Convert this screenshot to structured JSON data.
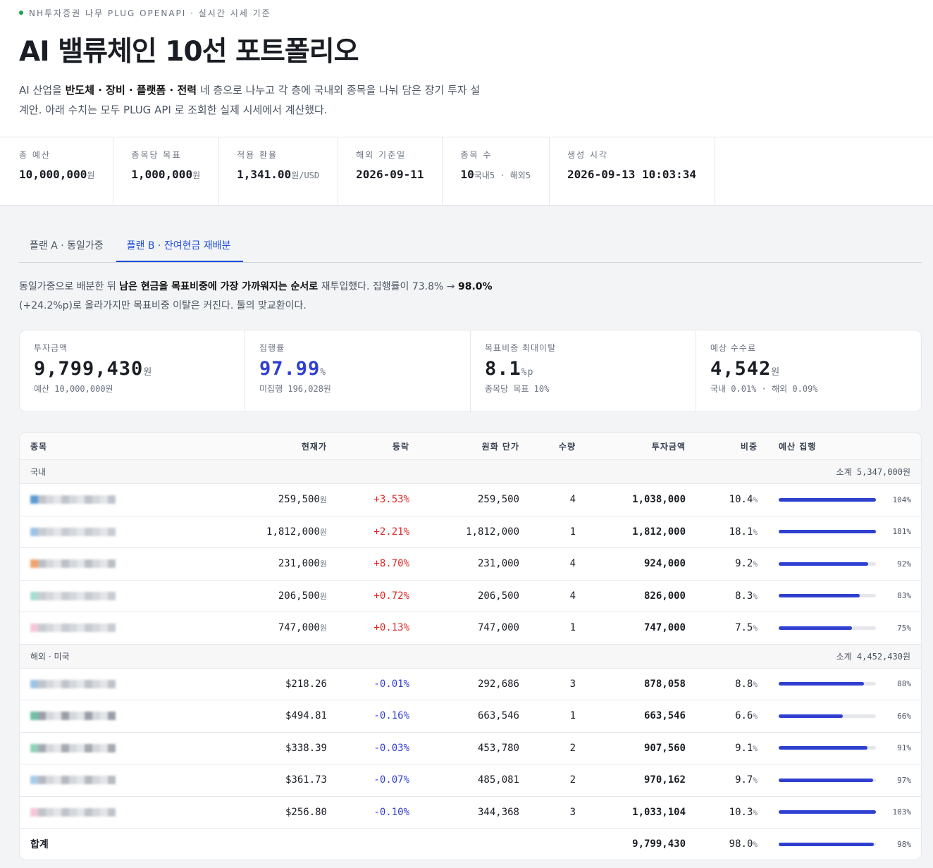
{
  "header": {
    "eyebrow": "NH투자증권 나무 PLUG OPENAPI · 실시간 시세 기준",
    "title": "AI 밸류체인 10선 포트폴리오",
    "desc_1": "AI 산업을 ",
    "desc_bold": "반도체 · 장비 · 플랫폼 · 전력",
    "desc_2": " 네 층으로 나누고 각 층에 국내외 종목을 나눠 담은 장기 투자 설계안. 아래 수치는 모두 PLUG API 로 조회한 실제 시세에서 계산했다."
  },
  "stats": [
    {
      "label": "총 예산",
      "value": "10,000,000",
      "unit": "원"
    },
    {
      "label": "종목당 목표",
      "value": "1,000,000",
      "unit": "원"
    },
    {
      "label": "적용 환율",
      "value": "1,341.00",
      "unit": "원/USD"
    },
    {
      "label": "해외 기준일",
      "value": "2026-09-11",
      "unit": ""
    },
    {
      "label": "종목 수",
      "value": "10",
      "unit": "국내5 · 해외5"
    },
    {
      "label": "생성 시각",
      "value": "2026-09-13 10:03:34",
      "unit": ""
    }
  ],
  "tabs": {
    "a": "플랜 A · 동일가중",
    "b": "플랜 B · 잔여현금 재배분"
  },
  "note": {
    "p1": "동일가중으로 배분한 뒤 ",
    "b1": "남은 현금을 목표비중에 가장 가까워지는 순서로",
    "p2": " 재투입했다. 집행률이 73.8% → ",
    "b2": "98.0%",
    "p3": " (+24.2%p)로 올라가지만 목표비중 이탈은 커진다. 둘의 맞교환이다."
  },
  "kpis": [
    {
      "label": "투자금액",
      "value": "9,799,430",
      "unit": "원",
      "sub": "예산 10,000,000원"
    },
    {
      "label": "집행률",
      "value": "97.99",
      "unit": "%",
      "sub": "미집행 196,028원"
    },
    {
      "label": "목표비중 최대이탈",
      "value": "8.1",
      "unit": "%p",
      "sub": "종목당 목표 10%"
    },
    {
      "label": "예상 수수료",
      "value": "4,542",
      "unit": "원",
      "sub": "국내 0.01% · 해외 0.09%"
    }
  ],
  "table": {
    "headers": {
      "name": "종목",
      "price": "현재가",
      "chg": "등락",
      "krw": "원화 단가",
      "qty": "수량",
      "amt": "투자금액",
      "wt": "비중",
      "bar": "예산 집행"
    },
    "domestic": {
      "label": "국내",
      "subtotal": "소계 5,347,000원"
    },
    "overseas": {
      "label": "해외 · 미국",
      "subtotal": "소계 4,452,430원"
    },
    "total": {
      "label": "합계",
      "amt": "9,799,430",
      "wt": "98.0",
      "pct": "98%"
    }
  },
  "rows_domestic": [
    {
      "price": "259,500",
      "pu": "원",
      "chg": "+3.53%",
      "krw": "259,500",
      "qty": "4",
      "amt": "1,038,000",
      "wt": "10.4",
      "pct": "104%",
      "fill": 1.0,
      "c1": "#5b9bd5",
      "c2": "#bfc4cc"
    },
    {
      "price": "1,812,000",
      "pu": "원",
      "chg": "+2.21%",
      "krw": "1,812,000",
      "qty": "1",
      "amt": "1,812,000",
      "wt": "18.1",
      "pct": "181%",
      "fill": 1.0,
      "c1": "#9ec3e6",
      "c2": "#c8ccd2"
    },
    {
      "price": "231,000",
      "pu": "원",
      "chg": "+8.70%",
      "krw": "231,000",
      "qty": "4",
      "amt": "924,000",
      "wt": "9.2",
      "pct": "92%",
      "fill": 0.92,
      "c1": "#f0a36b",
      "c2": "#bcc0c6"
    },
    {
      "price": "206,500",
      "pu": "원",
      "chg": "+0.72%",
      "krw": "206,500",
      "qty": "4",
      "amt": "826,000",
      "wt": "8.3",
      "pct": "83%",
      "fill": 0.83,
      "c1": "#a8ddd0",
      "c2": "#c8ccd2"
    },
    {
      "price": "747,000",
      "pu": "원",
      "chg": "+0.13%",
      "krw": "747,000",
      "qty": "1",
      "amt": "747,000",
      "wt": "7.5",
      "pct": "75%",
      "fill": 0.75,
      "c1": "#f4c7d6",
      "c2": "#c8ccd2"
    }
  ],
  "rows_overseas": [
    {
      "price": "$218.26",
      "pu": "",
      "chg": "-0.01%",
      "krw": "292,686",
      "qty": "3",
      "amt": "878,058",
      "wt": "8.8",
      "pct": "88%",
      "fill": 0.88,
      "c1": "#9ec3e6",
      "c2": "#c0c4ca"
    },
    {
      "price": "$494.81",
      "pu": "",
      "chg": "-0.16%",
      "krw": "663,546",
      "qty": "1",
      "amt": "663,546",
      "wt": "6.6",
      "pct": "66%",
      "fill": 0.66,
      "c1": "#6fc0a6",
      "c2": "#9a9ea6"
    },
    {
      "price": "$338.39",
      "pu": "",
      "chg": "-0.03%",
      "krw": "453,780",
      "qty": "2",
      "amt": "907,560",
      "wt": "9.1",
      "pct": "91%",
      "fill": 0.91,
      "c1": "#8fd0b8",
      "c2": "#a6aab0"
    },
    {
      "price": "$361.73",
      "pu": "",
      "chg": "-0.07%",
      "krw": "485,081",
      "qty": "2",
      "amt": "970,162",
      "wt": "9.7",
      "pct": "97%",
      "fill": 0.97,
      "c1": "#a9cbe8",
      "c2": "#b6bac0"
    },
    {
      "price": "$256.80",
      "pu": "",
      "chg": "-0.10%",
      "krw": "344,368",
      "qty": "3",
      "amt": "1,033,104",
      "wt": "10.3",
      "pct": "103%",
      "fill": 1.0,
      "c1": "#f4c7d6",
      "c2": "#c0c4ca"
    }
  ],
  "colors": {
    "accent": "#2f3fd0",
    "up": "#dc2626",
    "down": "#2f3fd0",
    "live": "#16a34a"
  }
}
